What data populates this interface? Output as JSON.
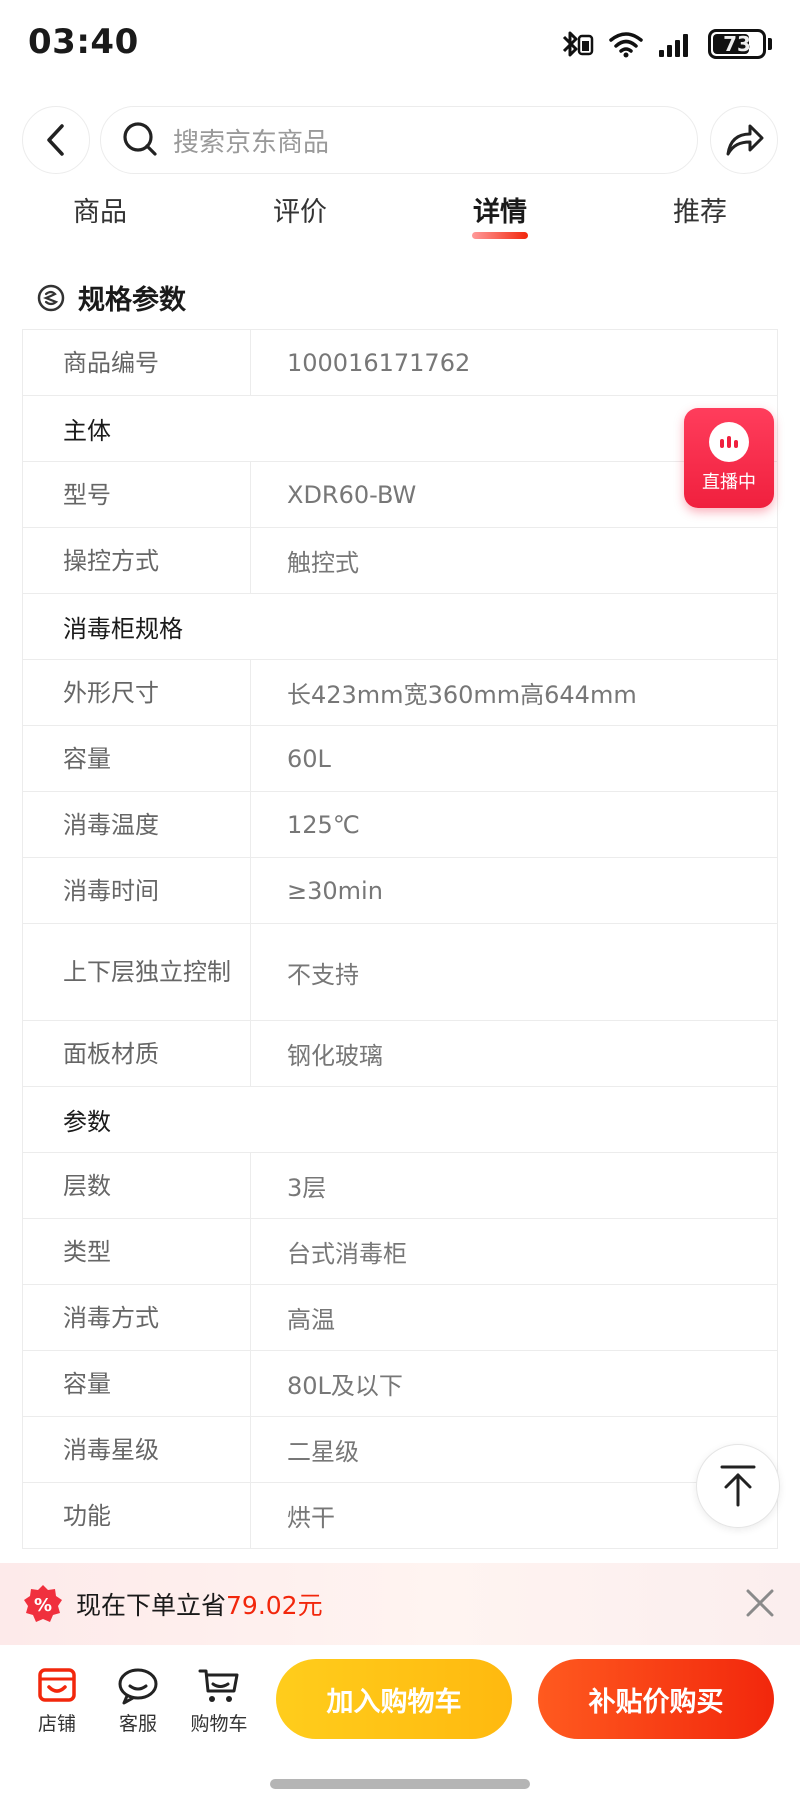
{
  "status_bar": {
    "time": "03:40",
    "battery": "73",
    "icons": [
      "bluetooth-icon",
      "wifi-icon",
      "signal-icon",
      "battery-icon"
    ]
  },
  "header": {
    "search_placeholder": "搜索京东商品"
  },
  "tabs": [
    {
      "label": "商品",
      "active": false
    },
    {
      "label": "评价",
      "active": false
    },
    {
      "label": "详情",
      "active": true
    },
    {
      "label": "推荐",
      "active": false
    }
  ],
  "section": {
    "title": "规格参数"
  },
  "specs": [
    {
      "type": "row",
      "key": "商品编号",
      "value": "100016171762"
    },
    {
      "type": "group",
      "label": "主体"
    },
    {
      "type": "row",
      "key": "型号",
      "value": "XDR60-BW"
    },
    {
      "type": "row",
      "key": "操控方式",
      "value": "触控式"
    },
    {
      "type": "group",
      "label": "消毒柜规格"
    },
    {
      "type": "row",
      "key": "外形尺寸",
      "value": "长423mm宽360mm高644mm"
    },
    {
      "type": "row",
      "key": "容量",
      "value": "60L"
    },
    {
      "type": "row",
      "key": "消毒温度",
      "value": "125℃"
    },
    {
      "type": "row",
      "key": "消毒时间",
      "value": "≥30min"
    },
    {
      "type": "row",
      "key": "上下层独立控制",
      "value": "不支持",
      "tall": true
    },
    {
      "type": "row",
      "key": "面板材质",
      "value": "钢化玻璃"
    },
    {
      "type": "group",
      "label": "参数"
    },
    {
      "type": "row",
      "key": "层数",
      "value": "3层"
    },
    {
      "type": "row",
      "key": "类型",
      "value": "台式消毒柜"
    },
    {
      "type": "row",
      "key": "消毒方式",
      "value": "高温"
    },
    {
      "type": "row",
      "key": "容量",
      "value": "80L及以下"
    },
    {
      "type": "row",
      "key": "消毒星级",
      "value": "二星级"
    },
    {
      "type": "row",
      "key": "功能",
      "value": "烘干"
    }
  ],
  "live_badge": {
    "label": "直播中"
  },
  "promo": {
    "text": "现在下单立省",
    "amount": "79.02元"
  },
  "bottom_bar": {
    "store_label": "店铺",
    "service_label": "客服",
    "cart_label": "购物车",
    "add_to_cart": "加入购物车",
    "buy_now": "补贴价购买"
  },
  "colors": {
    "accent_red": "#f2270c",
    "cart_yellow": "#ffbf14",
    "live_red": "#f0203e"
  }
}
